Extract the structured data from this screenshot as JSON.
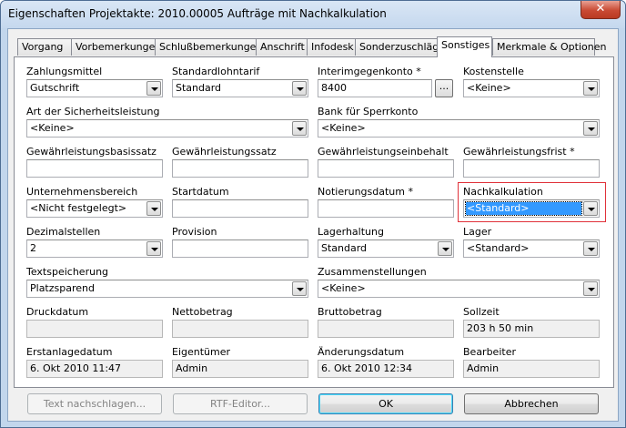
{
  "window": {
    "title": "Eigenschaften Projektakte: 2010.00005 Aufträge mit Nachkalkulation",
    "close_label": "✕"
  },
  "tabs": [
    {
      "label": "Vorgang"
    },
    {
      "label": "Vorbemerkungen"
    },
    {
      "label": "Schlußbemerkungen"
    },
    {
      "label": "Anschrift"
    },
    {
      "label": "Infodesk"
    },
    {
      "label": "Sonderzuschläge"
    },
    {
      "label": "Sonstiges",
      "active": true
    },
    {
      "label": "Merkmale & Optionen"
    }
  ],
  "fields": {
    "zahlungsmittel": {
      "label": "Zahlungsmittel",
      "value": "Gutschrift"
    },
    "standardlohntarif": {
      "label": "Standardlohntarif",
      "value": "Standard"
    },
    "interimgegenkonto": {
      "label": "Interimgegenkonto *",
      "value": "8400",
      "button": "..."
    },
    "kostenstelle": {
      "label": "Kostenstelle",
      "value": "<Keine>"
    },
    "sicherheitsleistung": {
      "label": "Art der Sicherheitsleistung",
      "value": "<Keine>"
    },
    "sperrkonto": {
      "label": "Bank für Sperrkonto",
      "value": "<Keine>"
    },
    "gewaehr_basissatz": {
      "label": "Gewährleistungsbasissatz",
      "value": ""
    },
    "gewaehr_satz": {
      "label": "Gewährleistungssatz",
      "value": ""
    },
    "gewaehr_einbehalt": {
      "label": "Gewährleistungseinbehalt",
      "value": ""
    },
    "gewaehr_frist": {
      "label": "Gewährleistungsfrist *",
      "value": ""
    },
    "unternehmensbereich": {
      "label": "Unternehmensbereich",
      "value": "<Nicht festgelegt>"
    },
    "startdatum": {
      "label": "Startdatum",
      "value": ""
    },
    "notierungsdatum": {
      "label": "Notierungsdatum *",
      "value": ""
    },
    "nachkalkulation": {
      "label": "Nachkalkulation",
      "value": "<Standard>"
    },
    "dezimalstellen": {
      "label": "Dezimalstellen",
      "value": "2"
    },
    "provision": {
      "label": "Provision",
      "value": ""
    },
    "lagerhaltung": {
      "label": "Lagerhaltung",
      "value": "Standard"
    },
    "lager": {
      "label": "Lager",
      "value": "<Standard>"
    },
    "textspeicherung": {
      "label": "Textspeicherung",
      "value": "Platzsparend"
    },
    "zusammenstellungen": {
      "label": "Zusammenstellungen",
      "value": "<Keine>"
    },
    "druckdatum": {
      "label": "Druckdatum",
      "value": ""
    },
    "nettobetrag": {
      "label": "Nettobetrag",
      "value": ""
    },
    "bruttobetrag": {
      "label": "Bruttobetrag",
      "value": ""
    },
    "sollzeit": {
      "label": "Sollzeit",
      "value": "203 h 50 min"
    },
    "erstanlagedatum": {
      "label": "Erstanlagedatum",
      "value": "6. Okt 2010 11:47"
    },
    "eigentuemer": {
      "label": "Eigentümer",
      "value": "Admin"
    },
    "aenderungsdatum": {
      "label": "Änderungsdatum",
      "value": "6. Okt 2010 12:34"
    },
    "bearbeiter": {
      "label": "Bearbeiter",
      "value": "Admin"
    }
  },
  "buttons": {
    "text_nachschlagen": "Text nachschlagen...",
    "rtf_editor": "RTF-Editor...",
    "ok": "OK",
    "abbrechen": "Abbrechen"
  },
  "colors": {
    "selection": "#3399ff",
    "highlight_border": "#e0323a",
    "window_frame": "#c2d6ec"
  }
}
